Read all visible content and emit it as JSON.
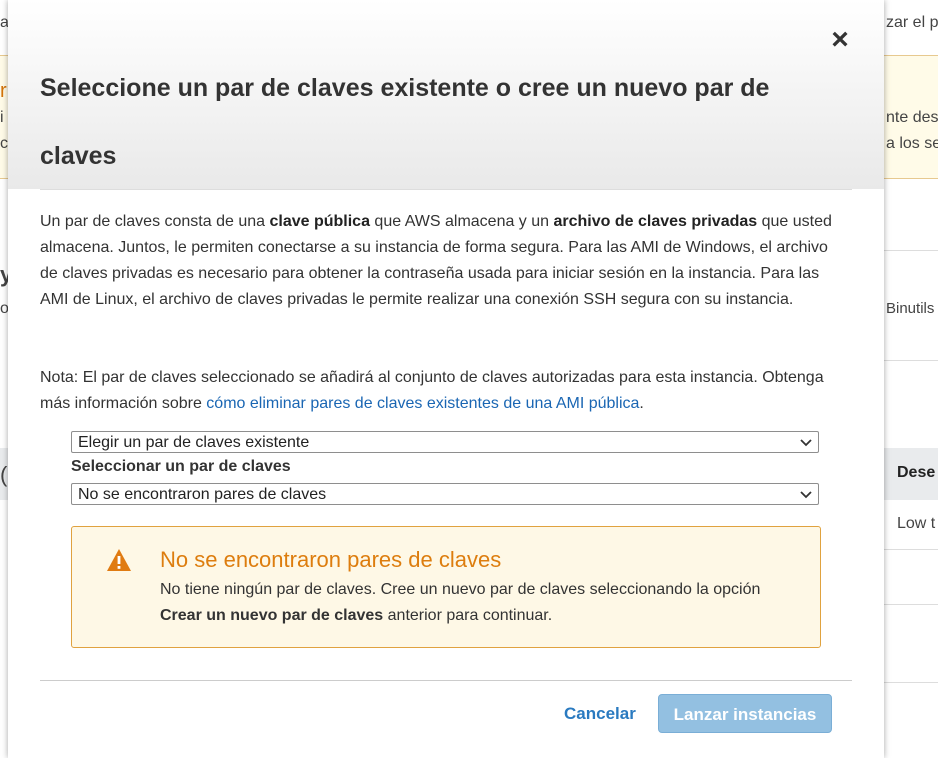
{
  "background": {
    "right_texts": [
      "zar el pr",
      "nte dese",
      "a los se",
      "Binutils",
      "Dese",
      "Low t"
    ],
    "left_texts": [
      "a",
      "r",
      "i",
      "c",
      "y",
      "oc",
      "("
    ]
  },
  "modal": {
    "title": "Seleccione un par de claves existente o cree un nuevo par de claves",
    "close_label": "×",
    "description": {
      "p1": "Un par de claves consta de una ",
      "b1": "clave pública",
      "p2": " que AWS almacena y un ",
      "b2": "archivo de claves privadas",
      "p3": " que usted almacena. Juntos, le permiten conectarse a su instancia de forma segura. Para las AMI de Windows, el archivo de claves privadas es necesario para obtener la contraseña usada para iniciar sesión en la instancia. Para las AMI de Linux, el archivo de claves privadas le permite realizar una conexión SSH segura con su instancia."
    },
    "note": {
      "text": "Nota: El par de claves seleccionado se añadirá al conjunto de claves autorizadas para esta instancia. Obtenga más información sobre ",
      "link": "cómo eliminar pares de claves existentes de una AMI pública",
      "end": "."
    },
    "keypair_option_select": "Elegir un par de claves existente",
    "keypair_label": "Seleccionar un par de claves",
    "keypair_select": "No se encontraron pares de claves",
    "alert": {
      "title": "No se encontraron pares de claves",
      "text1": "No tiene ningún par de claves. Cree un nuevo par de claves seleccionando la opción ",
      "bold": "Crear un nuevo par de claves",
      "text2": " anterior para continuar."
    },
    "buttons": {
      "cancel": "Cancelar",
      "launch": "Lanzar instancias"
    }
  },
  "colors": {
    "alert_title": "#dd7d0e",
    "alert_border": "#e0a23f",
    "link": "#1a66b3",
    "primary_button": "#93c0e1"
  }
}
